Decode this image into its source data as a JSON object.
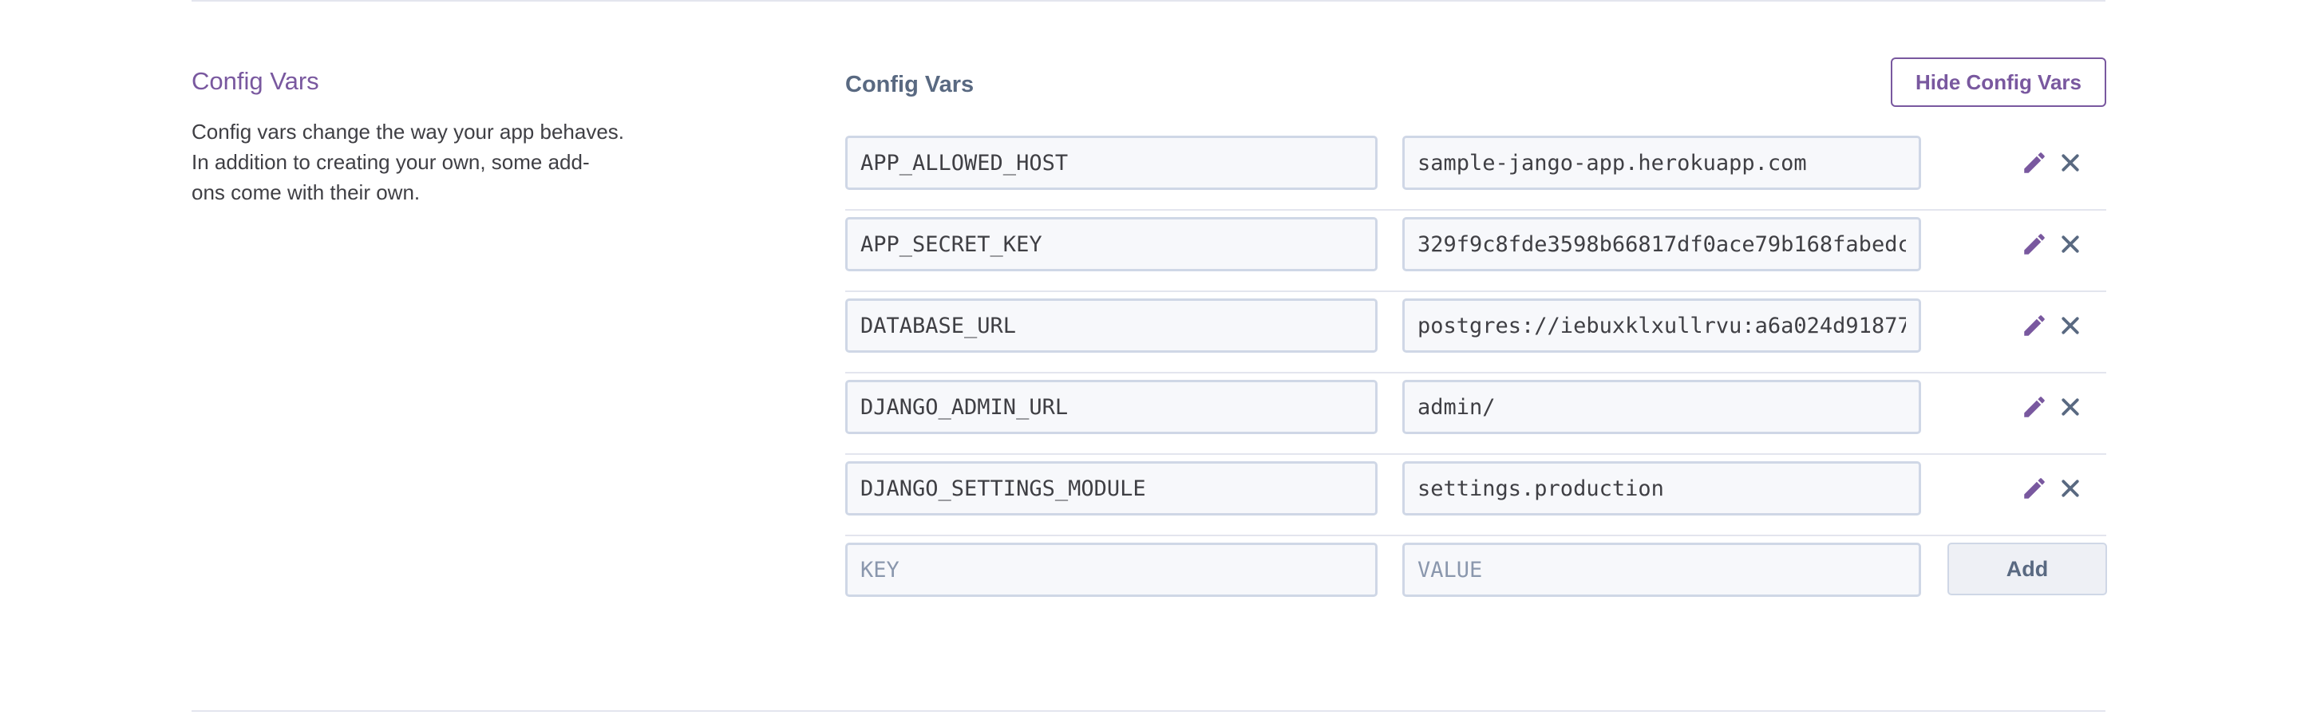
{
  "section": {
    "title": "Config Vars",
    "description_lines": [
      "Config vars change the way your app behaves.",
      "In addition to creating your own, some add-",
      "ons come with their own."
    ]
  },
  "panel": {
    "title": "Config Vars",
    "hide_button_label": "Hide Config Vars"
  },
  "vars": [
    {
      "key": "APP_ALLOWED_HOST",
      "value": "sample-jango-app.herokuapp.com"
    },
    {
      "key": "APP_SECRET_KEY",
      "value": "329f9c8fde3598b66817df0ace79b168fabedc"
    },
    {
      "key": "DATABASE_URL",
      "value": "postgres://iebuxklxullrvu:a6a024d91877"
    },
    {
      "key": "DJANGO_ADMIN_URL",
      "value": "admin/"
    },
    {
      "key": "DJANGO_SETTINGS_MODULE",
      "value": "settings.production"
    }
  ],
  "new_var": {
    "key_placeholder": "KEY",
    "value_placeholder": "VALUE",
    "add_label": "Add"
  },
  "icons": {
    "edit": "pencil-icon",
    "delete": "close-icon"
  },
  "colors": {
    "accent": "#79589f",
    "muted_text": "#596981",
    "body_text": "#3f3f44",
    "input_border": "#cfd7e6",
    "input_bg": "#f7f8fb",
    "divider": "#e3e5ee"
  }
}
